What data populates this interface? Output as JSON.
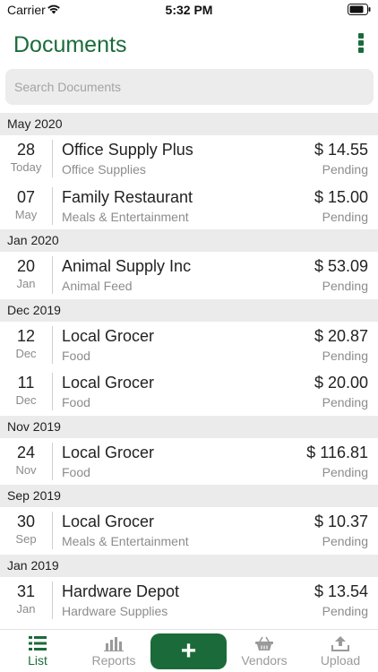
{
  "status_bar": {
    "carrier": "Carrier",
    "time": "5:32 PM"
  },
  "header": {
    "title": "Documents"
  },
  "search": {
    "placeholder": "Search Documents"
  },
  "sections": [
    {
      "label": "May 2020",
      "rows": [
        {
          "day": "28",
          "month": "Today",
          "vendor": "Office Supply Plus",
          "category": "Office Supplies",
          "amount": "$ 14.55",
          "status": "Pending"
        },
        {
          "day": "07",
          "month": "May",
          "vendor": "Family Restaurant",
          "category": "Meals & Entertainment",
          "amount": "$ 15.00",
          "status": "Pending"
        }
      ]
    },
    {
      "label": "Jan 2020",
      "rows": [
        {
          "day": "20",
          "month": "Jan",
          "vendor": "Animal Supply Inc",
          "category": "Animal Feed",
          "amount": "$ 53.09",
          "status": "Pending"
        }
      ]
    },
    {
      "label": "Dec 2019",
      "rows": [
        {
          "day": "12",
          "month": "Dec",
          "vendor": "Local Grocer",
          "category": "Food",
          "amount": "$ 20.87",
          "status": "Pending"
        },
        {
          "day": "11",
          "month": "Dec",
          "vendor": "Local Grocer",
          "category": "Food",
          "amount": "$ 20.00",
          "status": "Pending"
        }
      ]
    },
    {
      "label": "Nov 2019",
      "rows": [
        {
          "day": "24",
          "month": "Nov",
          "vendor": "Local Grocer",
          "category": "Food",
          "amount": "$ 116.81",
          "status": "Pending"
        }
      ]
    },
    {
      "label": "Sep 2019",
      "rows": [
        {
          "day": "30",
          "month": "Sep",
          "vendor": "Local Grocer",
          "category": "Meals & Entertainment",
          "amount": "$ 10.37",
          "status": "Pending"
        }
      ]
    },
    {
      "label": "Jan 2019",
      "rows": [
        {
          "day": "31",
          "month": "Jan",
          "vendor": "Hardware Depot",
          "category": "Hardware Supplies",
          "amount": "$ 13.54",
          "status": "Pending"
        }
      ]
    }
  ],
  "tab_bar": {
    "list": "List",
    "reports": "Reports",
    "add": "+",
    "vendors": "Vendors",
    "upload": "Upload"
  },
  "colors": {
    "accent": "#1b6b3a",
    "muted": "#8c8c8c",
    "section_bg": "#ebebeb"
  },
  "icons": {
    "wifi": "wifi-icon",
    "battery": "battery-icon",
    "more": "more-vertical-icon",
    "list": "list-icon",
    "reports": "bar-chart-icon",
    "vendors": "basket-icon",
    "upload": "upload-icon"
  }
}
